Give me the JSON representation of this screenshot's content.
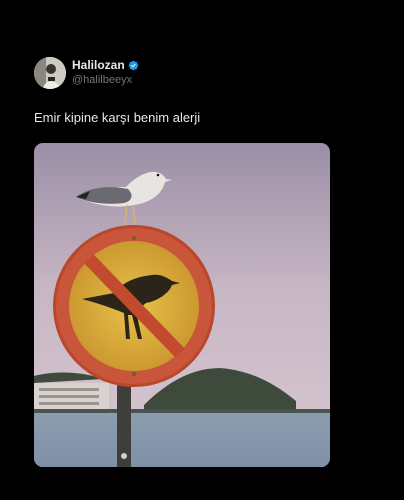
{
  "tweet": {
    "author": {
      "display_name": "Halilozan",
      "handle": "@halilbeeyx",
      "verified": true,
      "verified_color": "#1d9bf0"
    },
    "text": "Emir kipine karşı benim alerji",
    "media": {
      "description_icon": "photo"
    }
  },
  "colors": {
    "background": "#000000",
    "text_primary": "#e7e9ea",
    "text_secondary": "#71767b"
  }
}
